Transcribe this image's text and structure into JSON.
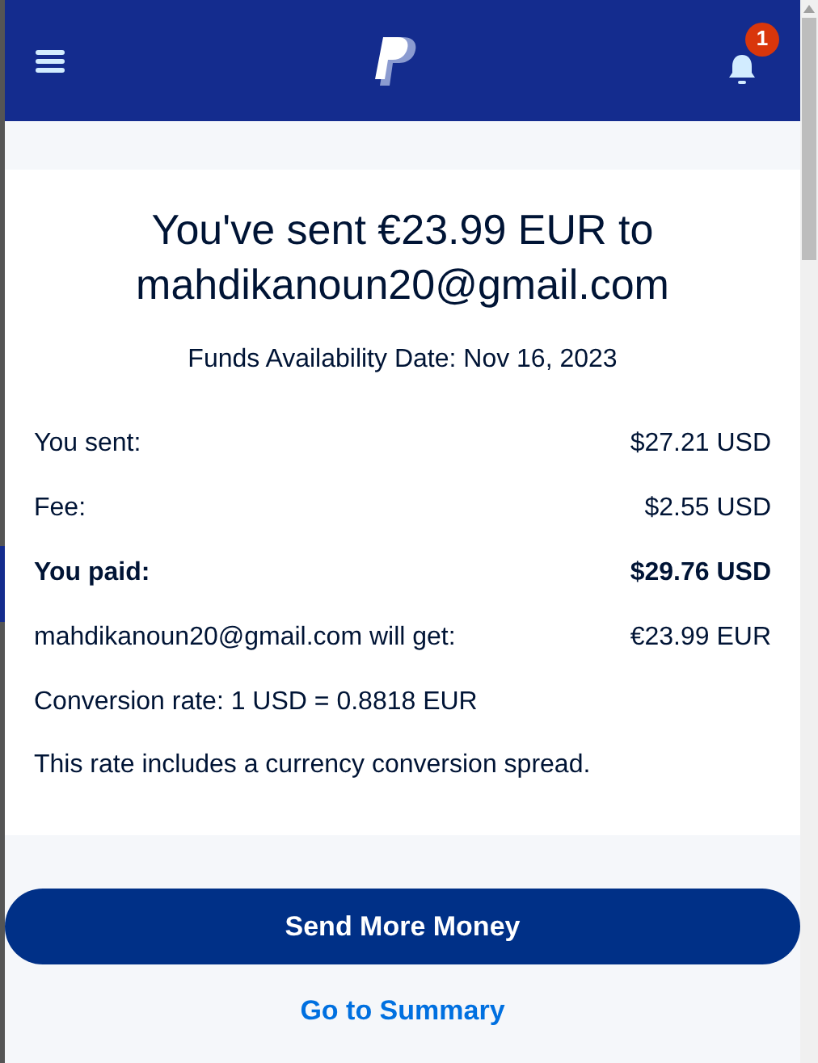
{
  "header": {
    "notification_count": "1"
  },
  "heading": "You've sent €23.99 EUR to mahdikanoun20@gmail.com",
  "availability": "Funds Availability Date: Nov 16, 2023",
  "rows": [
    {
      "label": "You sent:",
      "value": "$27.21 USD",
      "bold": false
    },
    {
      "label": "Fee:",
      "value": "$2.55 USD",
      "bold": false
    },
    {
      "label": "You paid:",
      "value": "$29.76 USD",
      "bold": true
    },
    {
      "label": "mahdikanoun20@gmail.com will get:",
      "value": "€23.99 EUR",
      "bold": false
    }
  ],
  "conversion_rate": "Conversion rate: 1 USD = 0.8818 EUR",
  "spread_note": "This rate includes a currency conversion spread.",
  "primary_button": "Send More Money",
  "summary_link": "Go to Summary"
}
